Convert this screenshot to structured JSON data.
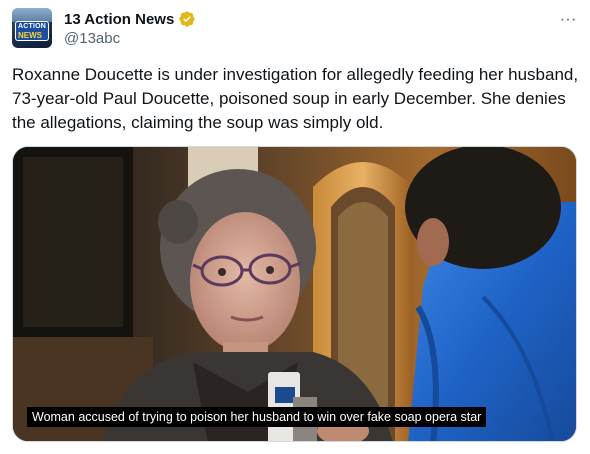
{
  "author": {
    "display_name": "13 Action News",
    "handle": "@13abc",
    "avatar_text_top": "ACTION",
    "avatar_text_bottom": "NEWS",
    "verified_color": "#e2b719"
  },
  "icons": {
    "more": "more-options-icon",
    "verified": "verified-badge-icon"
  },
  "more_glyph": "···",
  "tweet_text": "Roxanne Doucette is under investigation for allegedly feeding her husband, 73-year-old Paul Doucette, poisoned soup in early December. She denies the allegations, claiming the soup was simply old.",
  "media": {
    "caption": "Woman accused of trying to poison her husband to win over fake soap opera star",
    "jacket_color": "#1f63c7"
  }
}
